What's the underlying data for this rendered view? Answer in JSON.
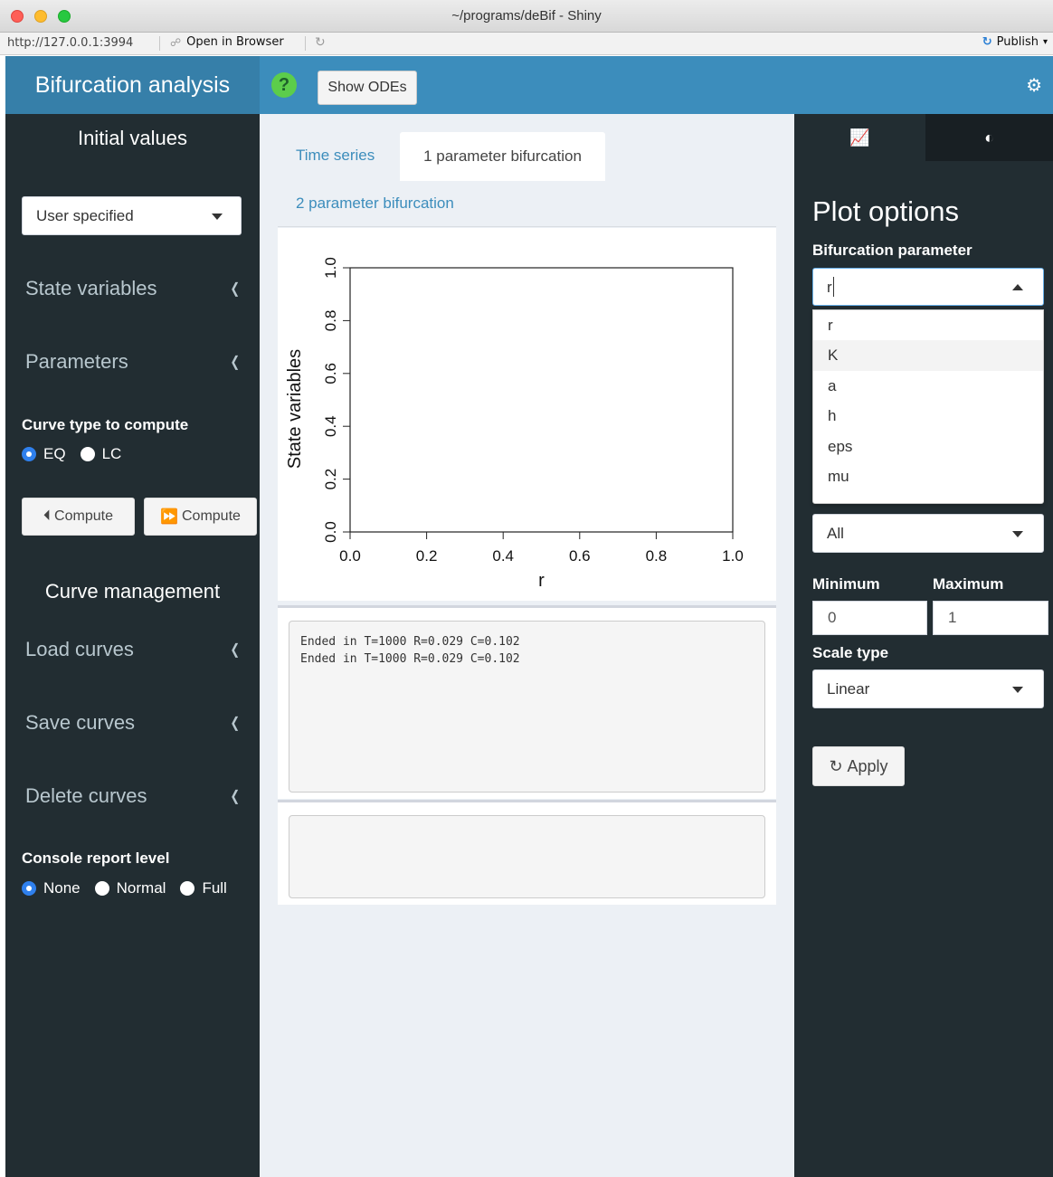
{
  "window": {
    "title": "~/programs/deBif - Shiny"
  },
  "addressbar": {
    "url": "http://127.0.0.1:3994",
    "open_in_browser": "Open in Browser",
    "publish": "Publish"
  },
  "header": {
    "brand": "Bifurcation analysis",
    "show_odes": "Show ODEs"
  },
  "sidebar": {
    "initial_values_title": "Initial values",
    "initial_values_select": "User specified",
    "state_variables": "State variables",
    "parameters": "Parameters",
    "curve_type_label": "Curve type to compute",
    "curve_types": [
      "EQ",
      "LC"
    ],
    "compute_back": "Compute",
    "compute_forward": "Compute",
    "curve_management_title": "Curve management",
    "load_curves": "Load curves",
    "save_curves": "Save curves",
    "delete_curves": "Delete curves",
    "console_level_label": "Console report level",
    "console_levels": [
      "None",
      "Normal",
      "Full"
    ]
  },
  "main": {
    "tabs": {
      "time_series": "Time series",
      "one_param": "1 parameter bifurcation",
      "two_param": "2 parameter bifurcation"
    },
    "console_lines": [
      "Ended in T=1000 R=0.029 C=0.102",
      "Ended in T=1000 R=0.029 C=0.102"
    ]
  },
  "chart_data": {
    "type": "line",
    "series": [],
    "xlabel": "r",
    "ylabel": "State variables",
    "xlim": [
      0,
      1
    ],
    "ylim": [
      0,
      1
    ],
    "xticks": [
      "0.0",
      "0.2",
      "0.4",
      "0.6",
      "0.8",
      "1.0"
    ],
    "yticks": [
      "0.0",
      "0.2",
      "0.4",
      "0.6",
      "0.8",
      "1.0"
    ]
  },
  "right": {
    "title": "Plot options",
    "bif_param_label": "Bifurcation parameter",
    "bif_param_value": "r",
    "bif_param_options": [
      "r",
      "K",
      "a",
      "h",
      "eps",
      "mu"
    ],
    "second_select_value": "All",
    "minimum_label": "Minimum",
    "maximum_label": "Maximum",
    "minimum_value": "0",
    "maximum_value": "1",
    "scale_type_label": "Scale type",
    "scale_type_value": "Linear",
    "apply": "Apply"
  }
}
